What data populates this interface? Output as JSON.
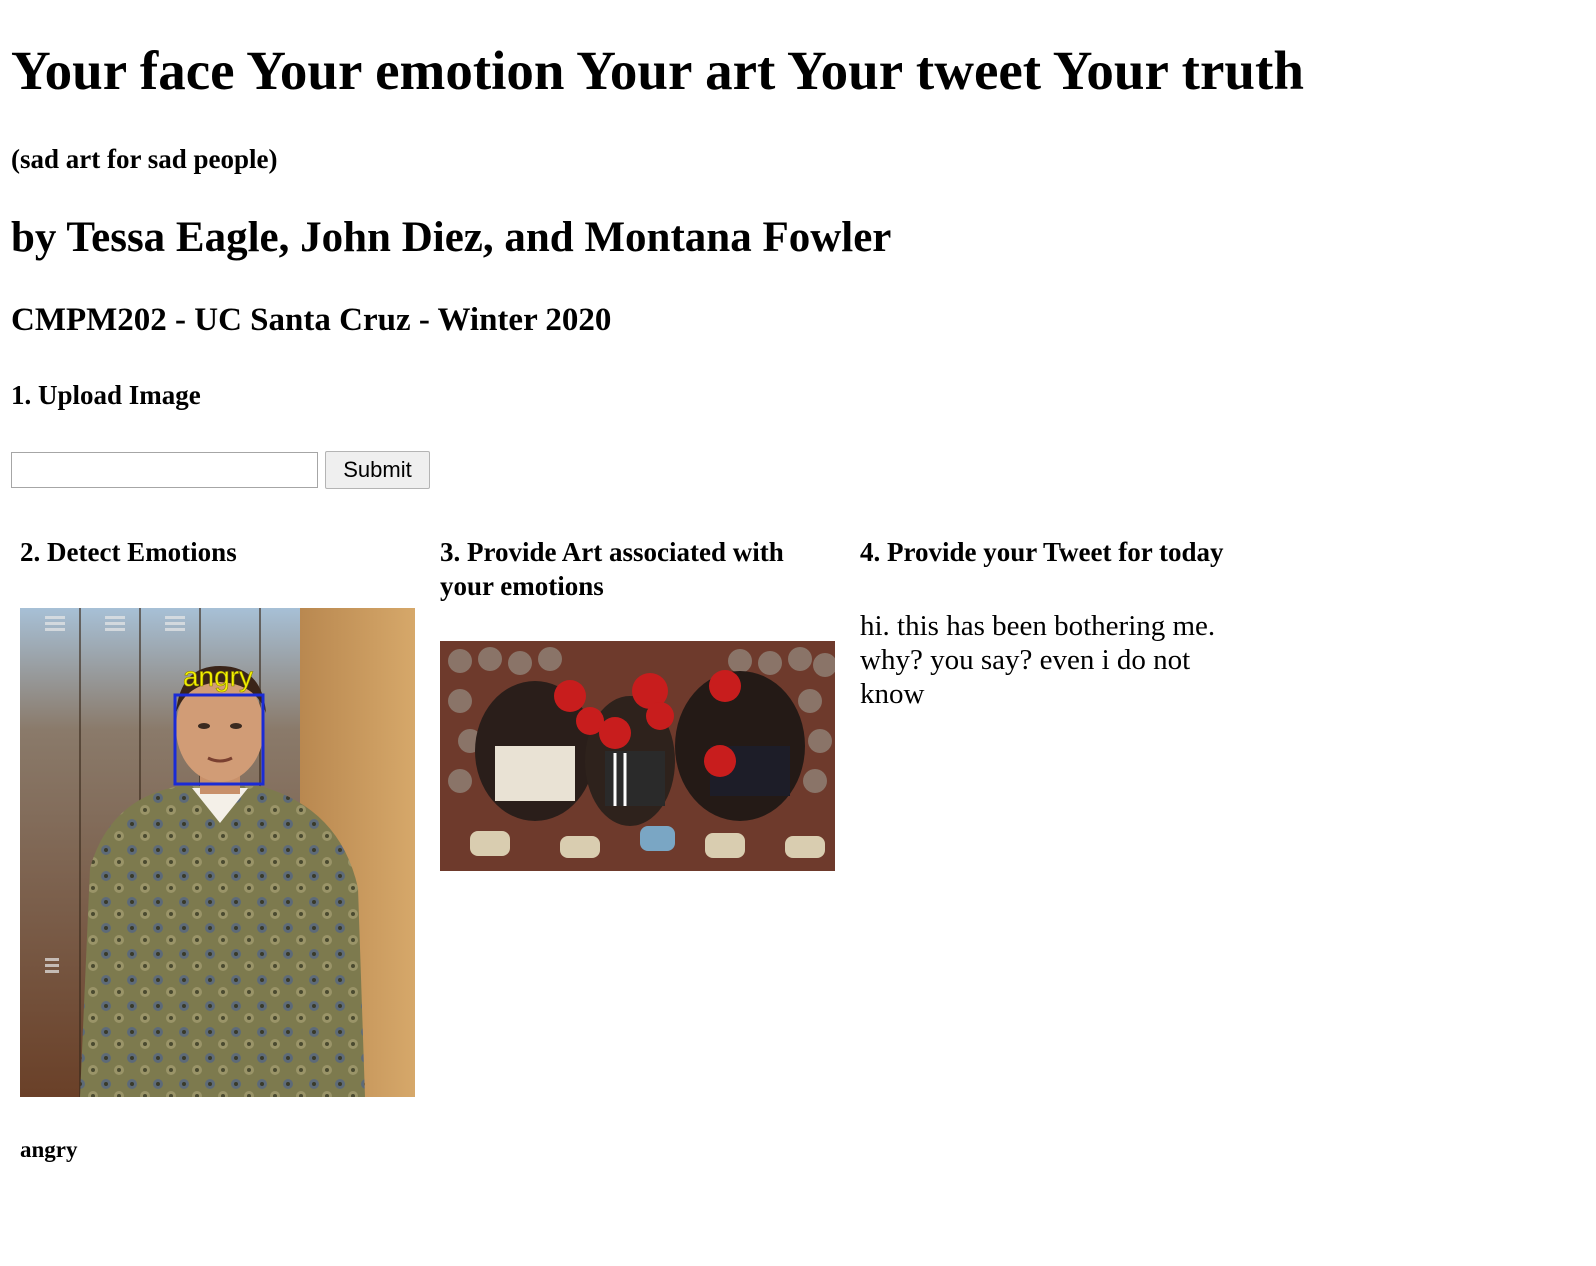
{
  "header": {
    "title": "Your face Your emotion Your art Your tweet Your truth",
    "subtitle": "(sad art for sad people)",
    "authors": "by Tessa Eagle, John Diez, and Montana Fowler",
    "course": "CMPM202 - UC Santa Cruz - Winter 2020"
  },
  "upload": {
    "heading": "1. Upload Image",
    "input_value": "",
    "submit_label": "Submit"
  },
  "detect": {
    "heading": "2. Detect Emotions",
    "photo_overlay_label": "angry",
    "result": "angry"
  },
  "art": {
    "heading": "3. Provide Art associated with your emotions"
  },
  "tweet": {
    "heading": "4. Provide your Tweet for today",
    "text": "hi. this has been bothering me. why? you say? even i do not know"
  },
  "colors": {
    "background": "#ffffff",
    "text": "#000000",
    "face_box": "#1a2bd6",
    "face_label": "#f4f000"
  }
}
